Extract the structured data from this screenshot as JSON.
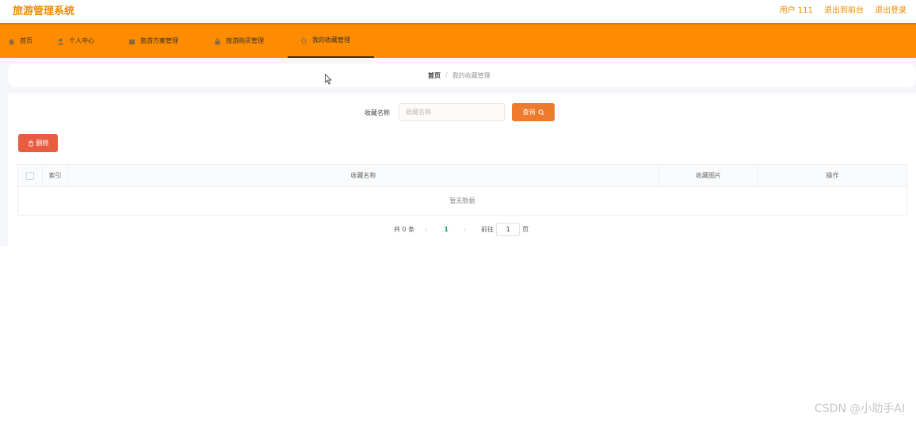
{
  "header": {
    "app_title": "旅游管理系统",
    "user_label": "用户 111",
    "to_frontend_label": "退出到前台",
    "logout_label": "退出登录"
  },
  "nav": {
    "items": [
      {
        "label": "首页",
        "icon": "home-icon"
      },
      {
        "label": "个人中心",
        "icon": "user-icon"
      },
      {
        "label": "旅游方案管理",
        "icon": "document-icon"
      },
      {
        "label": "旅游购买管理",
        "icon": "lock-icon"
      },
      {
        "label": "我的收藏管理",
        "icon": "star-icon",
        "active": true
      }
    ]
  },
  "breadcrumb": {
    "home": "首页",
    "separator": "/",
    "current": "我的收藏管理"
  },
  "search": {
    "label": "收藏名称",
    "placeholder": "收藏名称",
    "value": "",
    "query_label": "查询"
  },
  "actions": {
    "delete_label": "删除"
  },
  "table": {
    "columns": [
      "索引",
      "收藏名称",
      "收藏图片",
      "操作"
    ],
    "rows": [],
    "empty_text": "暂无数据"
  },
  "pagination": {
    "total_text": "共 0 条",
    "current_page": "1",
    "goto_label": "前往",
    "goto_value": "1",
    "page_suffix": "页"
  },
  "watermark": "CSDN @小助手AI",
  "colors": {
    "accent": "#ff8c00",
    "query_button": "#ee7a2e",
    "delete_button": "#e85c41",
    "active_page": "#1aa06d"
  }
}
